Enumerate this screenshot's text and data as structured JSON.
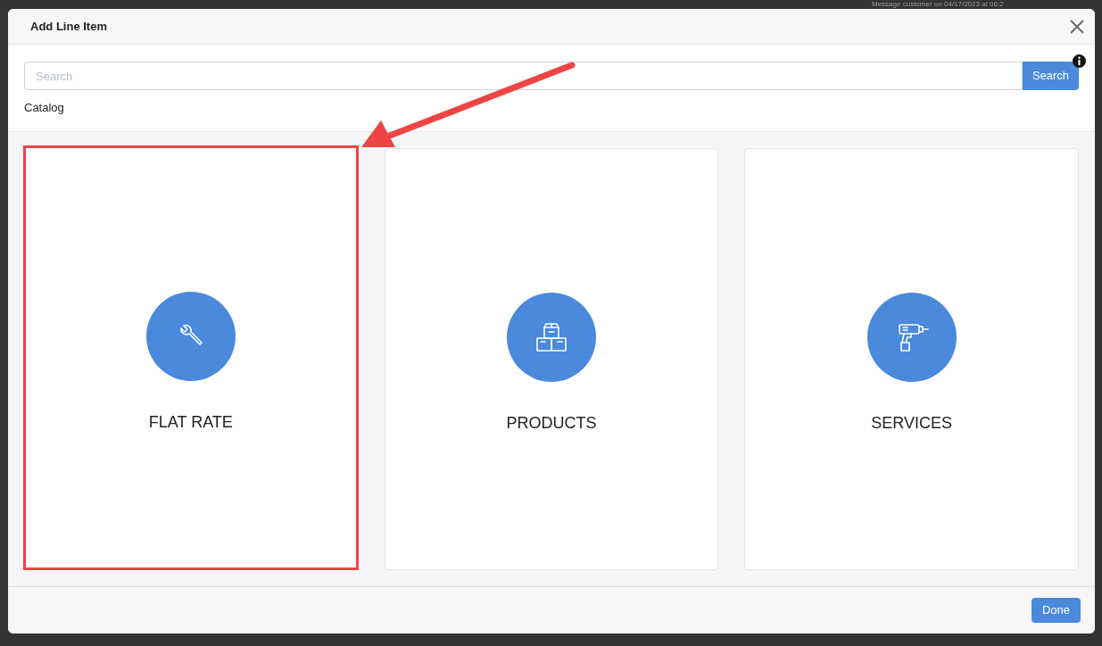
{
  "background": {
    "text": "Message customer on 04/17/2023 at 06:2"
  },
  "dialog": {
    "title": "Add Line Item"
  },
  "search": {
    "placeholder": "Search",
    "button": "Search"
  },
  "section_label": "Catalog",
  "categories": [
    {
      "label": "FLAT RATE",
      "kind": "wrench",
      "highlighted": true
    },
    {
      "label": "PRODUCTS",
      "kind": "boxes",
      "highlighted": false
    },
    {
      "label": "SERVICES",
      "kind": "drill",
      "highlighted": false
    }
  ],
  "footer": {
    "button": "Done"
  }
}
